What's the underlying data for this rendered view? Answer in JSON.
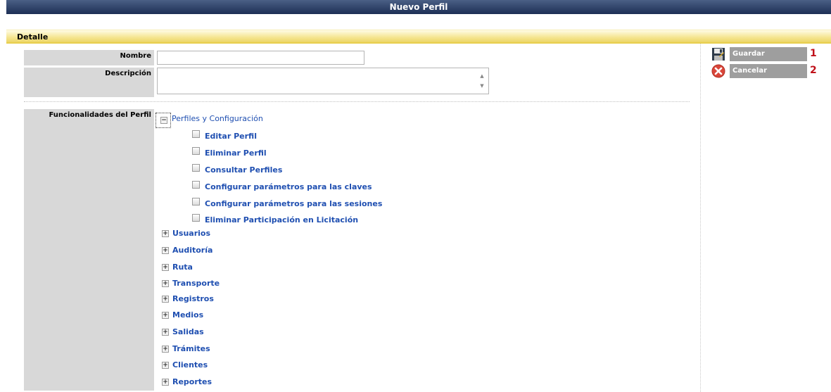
{
  "window": {
    "title": "Nuevo Perfil"
  },
  "section": {
    "title": "Detalle"
  },
  "form": {
    "nombre_label": "Nombre",
    "nombre_value": "",
    "descripcion_label": "Descripción",
    "descripcion_value": "",
    "funcionalidades_label": "Funcionalidades del Perfil"
  },
  "tree": {
    "root": {
      "label": "Perfiles y Configuración",
      "expanded": true,
      "children": [
        {
          "label": "Editar Perfil",
          "checked": false
        },
        {
          "label": "Eliminar Perfil",
          "checked": false
        },
        {
          "label": "Consultar Perfiles",
          "checked": false
        },
        {
          "label": "Configurar parámetros para las claves",
          "checked": false
        },
        {
          "label": "Configurar parámetros para las sesiones",
          "checked": false
        },
        {
          "label": "Eliminar Participación en Licitación",
          "checked": false
        }
      ]
    },
    "collapsed": [
      {
        "label": "Usuarios"
      },
      {
        "label": "Auditoría"
      },
      {
        "label": "Ruta"
      },
      {
        "label": "Transporte"
      },
      {
        "label": "Registros"
      },
      {
        "label": "Medios"
      },
      {
        "label": "Salidas"
      },
      {
        "label": "Trámites"
      },
      {
        "label": "Clientes"
      },
      {
        "label": "Reportes"
      }
    ]
  },
  "actions": {
    "save_label": "Guardar",
    "save_number": "1",
    "cancel_label": "Cancelar",
    "cancel_number": "2"
  },
  "icons": {
    "save": "floppy-disk-icon",
    "cancel": "cancel-x-icon",
    "expand": "plus-box-icon",
    "collapse": "minus-box-icon"
  },
  "colors": {
    "title_bar": "#1d2f55",
    "section_bar": "#f5e590",
    "link": "#1f4fb1",
    "button": "#9e9e9e",
    "number": "#c0111a",
    "cancel_icon": "#d9463a"
  }
}
